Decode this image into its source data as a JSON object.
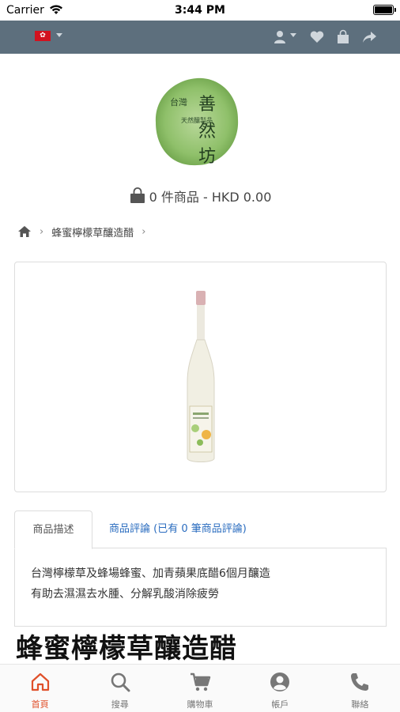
{
  "status_bar": {
    "carrier": "Carrier",
    "time": "3:44 PM"
  },
  "top_bar": {
    "icons": [
      "hk-flag-icon",
      "user-icon",
      "heart-icon",
      "shopping-bag-icon",
      "share-icon"
    ],
    "bar_color": "#5d6f7d"
  },
  "logo": {
    "text_main": "善然坊",
    "text_sub": "天然釀製品",
    "text_badge": "台灣"
  },
  "cart_summary": {
    "text": "0 件商品 - HKD 0.00"
  },
  "breadcrumb": {
    "current": "蜂蜜檸檬草釀造醋"
  },
  "tabs": [
    {
      "label": "商品描述",
      "active": true
    },
    {
      "label": "商品評論 (已有 0 筆商品評論)",
      "active": false
    }
  ],
  "description": {
    "line1": "台灣檸檬草及蜂場蜂蜜、加青蘋果底醋6個月釀造",
    "line2": "有助去濕濕去水腫、分解乳酸消除疲勞"
  },
  "product": {
    "title": "蜂蜜檸檬草釀造醋"
  },
  "bottom_nav": [
    {
      "label": "首頁",
      "icon": "home-icon",
      "active": true
    },
    {
      "label": "搜尋",
      "icon": "search-icon",
      "active": false
    },
    {
      "label": "購物車",
      "icon": "cart-icon",
      "active": false
    },
    {
      "label": "帳戶",
      "icon": "account-icon",
      "active": false
    },
    {
      "label": "聯絡",
      "icon": "phone-icon",
      "active": false
    }
  ],
  "colors": {
    "accent": "#e0502a",
    "link": "#2a6cbf",
    "logo_green": "#8fc06a"
  }
}
